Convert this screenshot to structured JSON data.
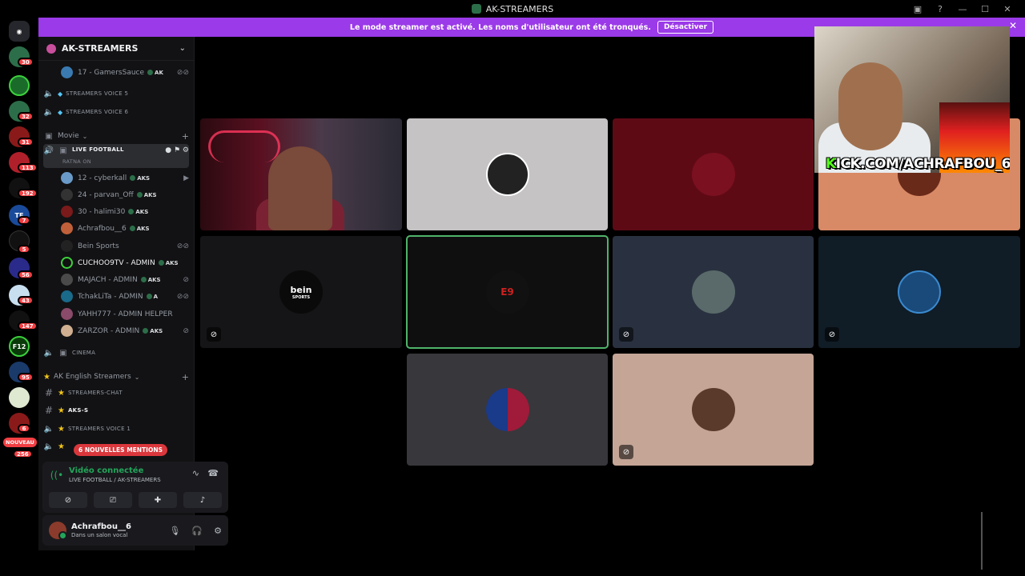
{
  "window": {
    "title": "AK-STREAMERS"
  },
  "banner": {
    "text": "Le mode streamer est activé. Les noms d'utilisateur ont été tronqués.",
    "button": "Désactiver"
  },
  "rail": {
    "badges": [
      "30",
      "32",
      "31",
      "113",
      "192",
      "7",
      "5",
      "56",
      "43",
      "147",
      "95",
      "6",
      "256"
    ],
    "nouveau": "NOUVEAU",
    "thumb_labels": {
      "f12": "F12"
    }
  },
  "server": {
    "name": "AK-STREAMERS"
  },
  "channels": {
    "top_user": "17 - GamersSauce",
    "top_user_tag": "AK",
    "voice5": "STREAMERS VOICE 5",
    "voice6": "STREAMERS VOICE 6",
    "cat_movie": "Movie",
    "live_football": "LIVE FOOTBALL",
    "live_status": "RATNA ON",
    "users": [
      {
        "name": "12 - cyberkall",
        "tag": "AKS"
      },
      {
        "name": "24 - parvan_Off",
        "tag": "AKS"
      },
      {
        "name": "30 - halimi30",
        "tag": "AKS"
      },
      {
        "name": "Achrafbou__6",
        "tag": "AKS"
      },
      {
        "name": "Bein Sports",
        "tag": ""
      },
      {
        "name": "CUCHOO9TV - ADMIN",
        "tag": "AKS"
      },
      {
        "name": "MAJACH - ADMIN",
        "tag": "AKS"
      },
      {
        "name": "TchakLiTa - ADMIN",
        "tag": "A"
      },
      {
        "name": "YAHH777 - ADMIN HELPER",
        "tag": ""
      },
      {
        "name": "ZARZOR - ADMIN",
        "tag": "AKS"
      }
    ],
    "cinema": "CINEMA",
    "cat_english": "AK English Streamers",
    "streamers_chat": "STREAMERS-CHAT",
    "aks_s": "AKS-S",
    "voice1": "STREAMERS VOICE 1",
    "mentions": "6 NOUVELLES MENTIONS"
  },
  "voice_panel": {
    "status": "Vidéo connectée",
    "channel": "LIVE FOOTBALL / AK-STREAMERS"
  },
  "user_panel": {
    "name": "Achrafbou__6",
    "status": "Dans un salon vocal"
  },
  "tiles": {
    "bein": "bein",
    "bein_sub": "SPORTS",
    "e9": "E9"
  },
  "stream_overlay": {
    "kick_k": "K",
    "kick_rest": "ICK.COM/ACHRAFBOU_6"
  },
  "colors": {
    "banner": "#9b3ae8",
    "connected": "#23a55a",
    "badge": "#f23f43",
    "kick": "#53fc18"
  }
}
